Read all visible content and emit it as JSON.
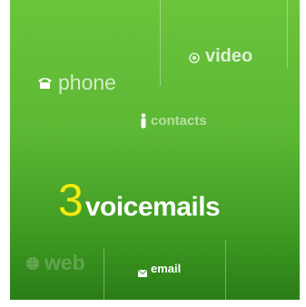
{
  "tiles": {
    "phone": {
      "label": "phone",
      "icon": "telephone-icon"
    },
    "video": {
      "label": "video",
      "icon": "video-record-icon"
    },
    "contacts": {
      "label": "contacts",
      "icon": "person-icon"
    },
    "voicemail": {
      "count": "3",
      "label": "voicemails"
    },
    "web": {
      "label": "web",
      "icon": "globe-icon"
    },
    "email": {
      "label": "email",
      "icon": "envelope-icon"
    }
  },
  "colors": {
    "background_top": "#6cc43c",
    "background_bottom": "#2b7d17",
    "count_accent": "#f2ea0f",
    "text": "#ffffff"
  }
}
